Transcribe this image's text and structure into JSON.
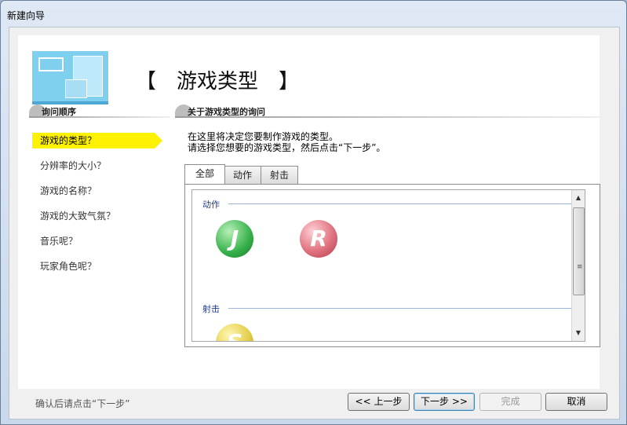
{
  "window": {
    "title": "新建向导"
  },
  "banner": {
    "title": "【　游戏类型　】"
  },
  "left_panel": {
    "header": "询问顺序",
    "steps": [
      {
        "label": "游戏的类型？",
        "active": true
      },
      {
        "label": "分辨率的大小？"
      },
      {
        "label": "游戏的名称？"
      },
      {
        "label": "游戏的大致气氛？"
      },
      {
        "label": "音乐呢？"
      },
      {
        "label": "玩家角色呢？"
      }
    ]
  },
  "right_panel": {
    "header": "关于游戏类型的询问",
    "desc_line1": "在这里将决定您要制作游戏的类型。",
    "desc_line2": "请选择您想要的游戏类型，然后点击“下一步”。",
    "tabs": [
      {
        "label": "全部",
        "active": true
      },
      {
        "label": "动作"
      },
      {
        "label": "射击"
      }
    ],
    "groups": [
      {
        "label": "动作",
        "items": [
          {
            "letter": "J",
            "icon": "j-game-icon",
            "color": "#35b04a"
          },
          {
            "letter": "R",
            "icon": "r-game-icon",
            "color": "#e07380"
          }
        ]
      },
      {
        "label": "射击",
        "items": [
          {
            "letter": "S",
            "icon": "s-game-icon",
            "color": "#e3cf4c"
          }
        ]
      }
    ]
  },
  "footer": {
    "hint": "确认后请点击“下一步”",
    "prev": "<< 上一步",
    "next": "下一步 >>",
    "finish": "完成",
    "cancel": "取消"
  }
}
